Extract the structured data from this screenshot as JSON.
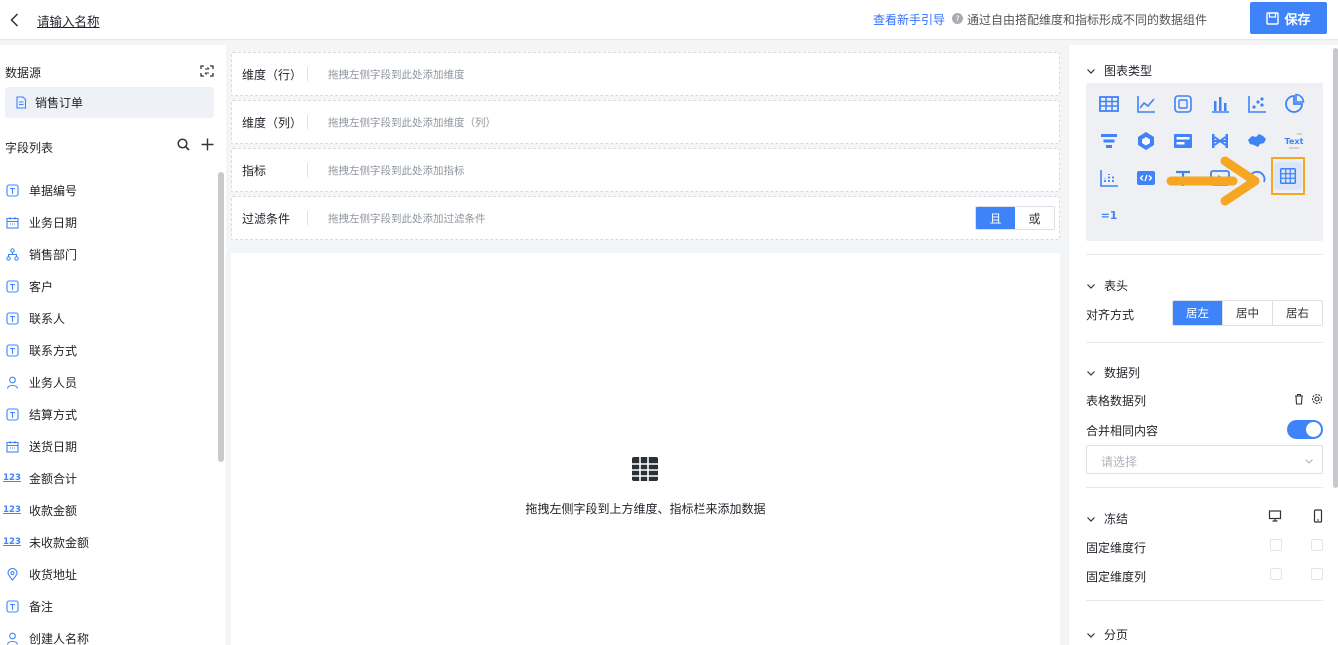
{
  "header": {
    "report_name": "请输入名称",
    "guide_link": "查看新手引导",
    "guide_desc": "通过自由搭配维度和指标形成不同的数据组件",
    "save_label": "保存"
  },
  "left": {
    "datasource_title": "数据源",
    "datasource_name": "销售订单",
    "field_list_title": "字段列表",
    "fields": [
      {
        "label": "单据编号",
        "icon": "text-field-icon"
      },
      {
        "label": "业务日期",
        "icon": "date-field-icon"
      },
      {
        "label": "销售部门",
        "icon": "org-field-icon"
      },
      {
        "label": "客户",
        "icon": "text-field-icon"
      },
      {
        "label": "联系人",
        "icon": "text-field-icon"
      },
      {
        "label": "联系方式",
        "icon": "text-field-icon"
      },
      {
        "label": "业务人员",
        "icon": "person-field-icon"
      },
      {
        "label": "结算方式",
        "icon": "text-field-icon"
      },
      {
        "label": "送货日期",
        "icon": "date-field-icon"
      },
      {
        "label": "金额合计",
        "icon": "number-field-icon",
        "glyph": "123"
      },
      {
        "label": "收款金额",
        "icon": "number-field-icon",
        "glyph": "123"
      },
      {
        "label": "未收款金额",
        "icon": "number-field-icon",
        "glyph": "123"
      },
      {
        "label": "收货地址",
        "icon": "location-field-icon"
      },
      {
        "label": "备注",
        "icon": "text-field-icon"
      },
      {
        "label": "创建人名称",
        "icon": "person-field-icon"
      }
    ]
  },
  "shelves": {
    "row": {
      "label": "维度（行）",
      "placeholder": "拖拽左侧字段到此处添加维度"
    },
    "col": {
      "label": "维度（列）",
      "placeholder": "拖拽左侧字段到此处添加维度（列）"
    },
    "metric": {
      "label": "指标",
      "placeholder": "拖拽左侧字段到此处添加指标"
    },
    "filter": {
      "label": "过滤条件",
      "placeholder": "拖拽左侧字段到此处添加过滤条件",
      "and_label": "且",
      "or_label": "或"
    }
  },
  "canvas": {
    "hint": "拖拽左侧字段到上方维度、指标栏来添加数据"
  },
  "right": {
    "chart_type_title": "图表类型",
    "chart_type_text_glyph": "Text",
    "chart_type_kpi_glyph": "=1",
    "header_title": "表头",
    "align_label": "对齐方式",
    "align_left": "居左",
    "align_center": "居中",
    "align_right": "居右",
    "columns_title": "数据列",
    "table_columns_label": "表格数据列",
    "merge_label": "合并相同内容",
    "merge_enabled": true,
    "select_placeholder": "请选择",
    "freeze_title": "冻结",
    "freeze_row_label": "固定维度行",
    "freeze_col_label": "固定维度列",
    "paging_title": "分页"
  },
  "colors": {
    "accent": "#3f83f8",
    "highlight": "#f5a623"
  }
}
